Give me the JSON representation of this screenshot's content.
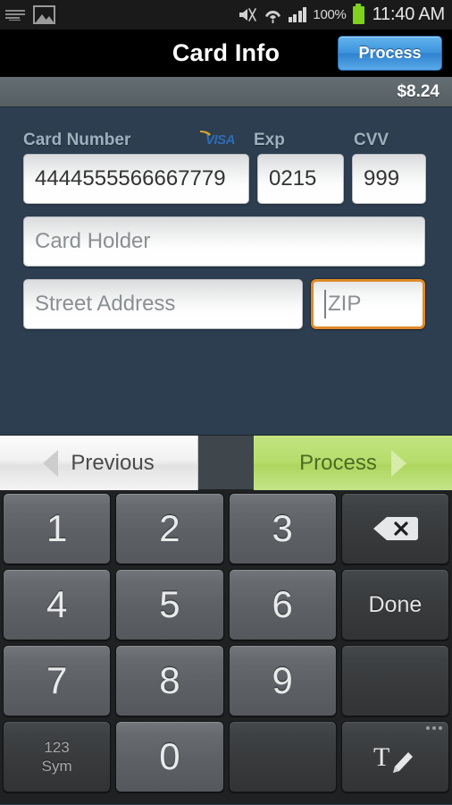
{
  "status_bar": {
    "icons_left": [
      "keyboard-icon",
      "screenshot-image-icon"
    ],
    "icons_right": [
      "mute-icon",
      "wifi-icon",
      "signal-icon"
    ],
    "battery_percent": "100%",
    "battery_icon": "battery-full-icon",
    "time": "11:40 AM"
  },
  "title_bar": {
    "title": "Card Info",
    "process_label": "Process"
  },
  "price_bar": {
    "amount": "$8.24"
  },
  "form": {
    "labels": {
      "card_number": "Card Number",
      "exp": "Exp",
      "cvv": "CVV"
    },
    "card_brand_icon": "visa-logo-icon",
    "card_brand": "VISA",
    "fields": {
      "card_number": {
        "value": "4444555566667779",
        "placeholder": "Card Number"
      },
      "exp": {
        "value": "0215",
        "placeholder": "Exp"
      },
      "cvv": {
        "value": "999",
        "placeholder": "CVV"
      },
      "card_holder": {
        "value": "",
        "placeholder": "Card Holder"
      },
      "street_address": {
        "value": "",
        "placeholder": "Street Address"
      },
      "zip": {
        "value": "",
        "placeholder": "ZIP",
        "focused": true
      }
    }
  },
  "nav_bar": {
    "previous_label": "Previous",
    "process_label": "Process",
    "prev_icon": "triangle-left-icon",
    "next_icon": "triangle-right-icon"
  },
  "keypad": {
    "rows": [
      [
        {
          "label": "1",
          "type": "num",
          "name": "key-1"
        },
        {
          "label": "2",
          "type": "num",
          "name": "key-2"
        },
        {
          "label": "3",
          "type": "num",
          "name": "key-3"
        },
        {
          "label": "",
          "type": "fn",
          "name": "key-backspace",
          "icon": "backspace-icon"
        }
      ],
      [
        {
          "label": "4",
          "type": "num",
          "name": "key-4"
        },
        {
          "label": "5",
          "type": "num",
          "name": "key-5"
        },
        {
          "label": "6",
          "type": "num",
          "name": "key-6"
        },
        {
          "label": "Done",
          "type": "fn",
          "name": "key-done"
        }
      ],
      [
        {
          "label": "7",
          "type": "num",
          "name": "key-7"
        },
        {
          "label": "8",
          "type": "num",
          "name": "key-8"
        },
        {
          "label": "9",
          "type": "num",
          "name": "key-9"
        },
        {
          "label": "",
          "type": "fn",
          "name": "key-blank-right"
        }
      ],
      [
        {
          "label": "123\nSym",
          "type": "fn",
          "name": "key-symbols"
        },
        {
          "label": "0",
          "type": "num",
          "name": "key-0"
        },
        {
          "label": "",
          "type": "fn",
          "name": "key-blank-space"
        },
        {
          "label": "",
          "type": "fn",
          "name": "key-handwriting",
          "icon": "handwriting-icon"
        }
      ]
    ],
    "symbols_line1": "123",
    "symbols_line2": "Sym",
    "done_label": "Done"
  },
  "colors": {
    "background": "#2c3e50",
    "title_bar": "#000000",
    "accent_blue": "#3d94dd",
    "accent_green": "#b6dd6b",
    "focus_orange": "#e08a28",
    "price_bar": "#5a6368",
    "battery_green": "#7fd11a"
  }
}
